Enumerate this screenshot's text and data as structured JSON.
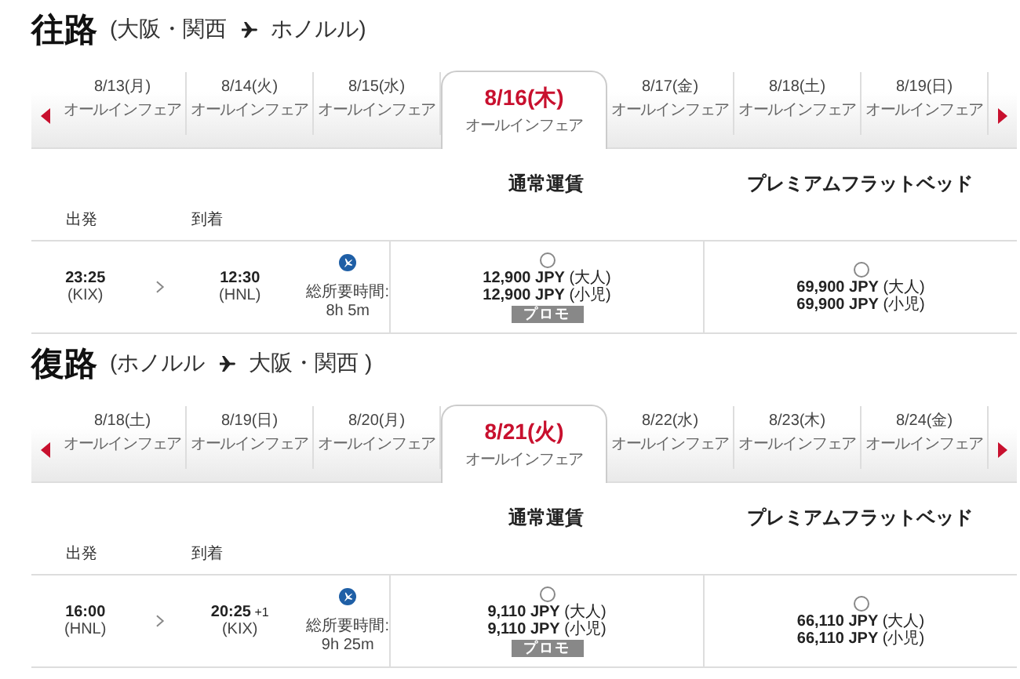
{
  "sections": [
    {
      "title": "往路",
      "route": {
        "from": "(大阪・関西",
        "to": "ホノルル)"
      },
      "dates": [
        {
          "date": "8/13(月)",
          "fare": "オールインフェア",
          "selected": false
        },
        {
          "date": "8/14(火)",
          "fare": "オールインフェア",
          "selected": false
        },
        {
          "date": "8/15(水)",
          "fare": "オールインフェア",
          "selected": false
        },
        {
          "date": "8/16(木)",
          "fare": "オールインフェア",
          "selected": true
        },
        {
          "date": "8/17(金)",
          "fare": "オールインフェア",
          "selected": false
        },
        {
          "date": "8/18(土)",
          "fare": "オールインフェア",
          "selected": false
        },
        {
          "date": "8/19(日)",
          "fare": "オールインフェア",
          "selected": false
        }
      ],
      "columns": {
        "depart": "出発",
        "arrive": "到着",
        "fares": [
          "通常運賃",
          "プレミアムフラットベッド"
        ]
      },
      "flight": {
        "dep_time": "23:25",
        "dep_airport": "(KIX)",
        "arr_time": "12:30",
        "arr_airport": "(HNL)",
        "duration_label": "総所要時間:",
        "duration": "8h 5m",
        "fares": [
          {
            "selected": false,
            "prices": [
              {
                "amount": "12,900 JPY",
                "passenger": "(大人)"
              },
              {
                "amount": "12,900 JPY",
                "passenger": "(小児)"
              }
            ],
            "badge": "プロモ"
          },
          {
            "selected": false,
            "prices": [
              {
                "amount": "69,900 JPY",
                "passenger": "(大人)"
              },
              {
                "amount": "69,900 JPY",
                "passenger": "(小児)"
              }
            ]
          }
        ]
      }
    },
    {
      "title": "復路",
      "route": {
        "from": "(ホノルル",
        "to": "大阪・関西 )"
      },
      "dates": [
        {
          "date": "8/18(土)",
          "fare": "オールインフェア",
          "selected": false
        },
        {
          "date": "8/19(日)",
          "fare": "オールインフェア",
          "selected": false
        },
        {
          "date": "8/20(月)",
          "fare": "オールインフェア",
          "selected": false
        },
        {
          "date": "8/21(火)",
          "fare": "オールインフェア",
          "selected": true
        },
        {
          "date": "8/22(水)",
          "fare": "オールインフェア",
          "selected": false
        },
        {
          "date": "8/23(木)",
          "fare": "オールインフェア",
          "selected": false
        },
        {
          "date": "8/24(金)",
          "fare": "オールインフェア",
          "selected": false
        }
      ],
      "columns": {
        "depart": "出発",
        "arrive": "到着",
        "fares": [
          "通常運賃",
          "プレミアムフラットベッド"
        ]
      },
      "flight": {
        "dep_time": "16:00",
        "dep_airport": "(HNL)",
        "arr_time": "20:25",
        "arr_next_day": "+1",
        "arr_airport": "(KIX)",
        "duration_label": "総所要時間:",
        "duration": "9h 25m",
        "fares": [
          {
            "selected": false,
            "prices": [
              {
                "amount": "9,110 JPY",
                "passenger": "(大人)"
              },
              {
                "amount": "9,110 JPY",
                "passenger": "(小児)"
              }
            ],
            "badge": "プロモ"
          },
          {
            "selected": false,
            "prices": [
              {
                "amount": "66,110 JPY",
                "passenger": "(大人)"
              },
              {
                "amount": "66,110 JPY",
                "passenger": "(小児)"
              }
            ]
          }
        ]
      }
    }
  ]
}
